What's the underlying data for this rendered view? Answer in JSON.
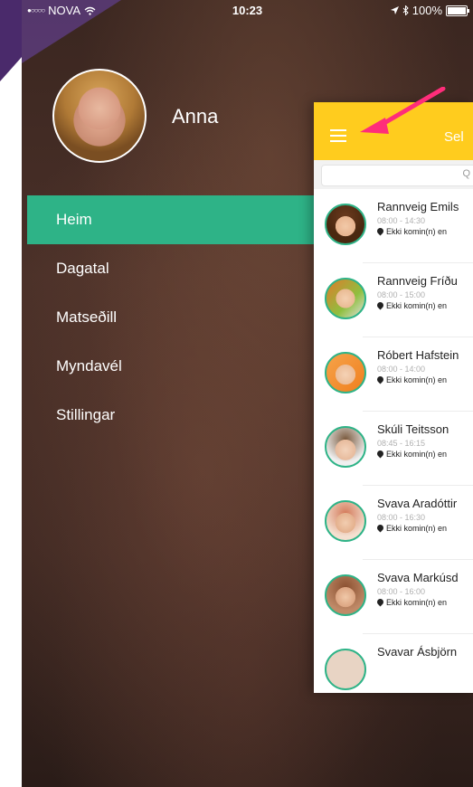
{
  "statusbar": {
    "carrier": "NOVA",
    "time": "10:23",
    "battery": "100%",
    "signal_icon": "signal-dots-icon",
    "wifi_icon": "wifi-icon",
    "location_icon": "location-arrow-icon",
    "bluetooth_icon": "bluetooth-icon",
    "battery_icon": "battery-icon"
  },
  "profile": {
    "name": "Anna",
    "avatar_icon": "user-avatar"
  },
  "menu": {
    "items": [
      {
        "label": "Heim",
        "active": true
      },
      {
        "label": "Dagatal",
        "active": false
      },
      {
        "label": "Matseðill",
        "active": false
      },
      {
        "label": "Myndavél",
        "active": false
      },
      {
        "label": "Stillingar",
        "active": false
      }
    ]
  },
  "panel": {
    "title": "Sel",
    "search_placeholder": "Q",
    "accent_color": "#ffcc1e",
    "children": [
      {
        "name": "Rannveig Emils",
        "time": "08:00 - 14:30",
        "status": "Ekki komin(n) en"
      },
      {
        "name": "Rannveig Fríðu",
        "time": "08:00 - 15:00",
        "status": "Ekki komin(n) en"
      },
      {
        "name": "Róbert Hafstein",
        "time": "08:00 - 14:00",
        "status": "Ekki komin(n) en"
      },
      {
        "name": "Skúli Teitsson",
        "time": "08:45 - 16:15",
        "status": "Ekki komin(n) en"
      },
      {
        "name": "Svava Aradóttir",
        "time": "08:00 - 16:30",
        "status": "Ekki komin(n) en"
      },
      {
        "name": "Svava Markúsd",
        "time": "08:00 - 16:00",
        "status": "Ekki komin(n) en"
      },
      {
        "name": "Svavar Ásbjörn",
        "time": "",
        "status": ""
      }
    ]
  },
  "colors": {
    "active_menu": "#2eb387",
    "annotation_arrow": "#ff2d7a"
  }
}
